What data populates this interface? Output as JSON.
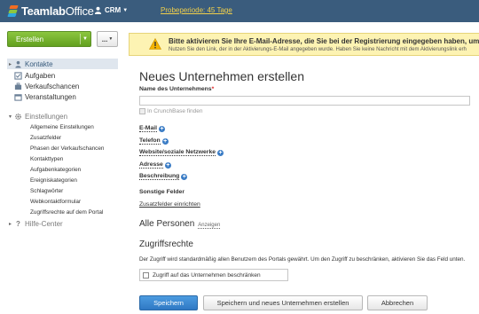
{
  "topbar": {
    "brand_main": "Teamlab",
    "brand_sub": "Office",
    "module": "CRM",
    "trial_link": "Probeperiode: 45 Tage"
  },
  "sidebar": {
    "create_button": "Erstellen",
    "more_button": "...",
    "items": [
      {
        "label": "Kontakte",
        "icon": "contacts-icon",
        "active": true
      },
      {
        "label": "Aufgaben",
        "icon": "tasks-icon"
      },
      {
        "label": "Verkaufschancen",
        "icon": "opportunities-icon"
      },
      {
        "label": "Veranstaltungen",
        "icon": "events-icon"
      }
    ],
    "settings": {
      "label": "Einstellungen",
      "icon": "gear-icon",
      "subitems": [
        "Allgemeine Einstellungen",
        "Zusatzfelder",
        "Phasen der Verkaufschancen",
        "Kontakttypen",
        "Aufgabenkategorien",
        "Ereigniskategorien",
        "Schlagwörter",
        "Webkontaktformular",
        "Zugriffsrechte auf dem Portal"
      ]
    },
    "help": {
      "label": "Hilfe-Center",
      "icon": "help-icon"
    }
  },
  "warning": {
    "icon": "warning-icon",
    "title": "Bitte aktivieren Sie Ihre E-Mail-Adresse, die Sie bei der Registrierung eingegeben haben, um",
    "text": "Nutzen Sie den Link, der in der Aktivierungs-E-Mail angegeben wurde. Haben Sie keine Nachricht mit dem Aktivierungslink erh"
  },
  "form": {
    "title": "Neues Unternehmen erstellen",
    "name_label": "Name des Unternehmens",
    "name_required": "*",
    "name_value": "",
    "crunchbase": "In CrunchBase finden",
    "email": "E-Mail",
    "phone": "Telefon",
    "website": "Website/soziale Netzwerke",
    "address": "Adresse",
    "description": "Beschreibung",
    "other_fields_title": "Sonstige Felder",
    "other_fields_link": "Zusatzfelder einrichten",
    "persons_title": "Alle Personen",
    "persons_show": "Anzeigen",
    "access_title": "Zugriffsrechte",
    "access_text": "Der Zugriff wird standardmäßig allen Benutzern des Portals gewährt. Um den Zugriff zu beschränken, aktivieren Sie das Feld unten.",
    "restrict_label": "Zugriff auf das Unternehmen beschränken",
    "restrict_checked": false
  },
  "buttons": {
    "save": "Speichern",
    "save_new": "Speichern und neues Unternehmen erstellen",
    "cancel": "Abbrechen"
  },
  "colors": {
    "topbar": "#3a5c7d",
    "create": "#6aa825",
    "primary": "#3a87d0",
    "warning_bg": "#fdf3b3",
    "trial": "#f2d04a"
  }
}
